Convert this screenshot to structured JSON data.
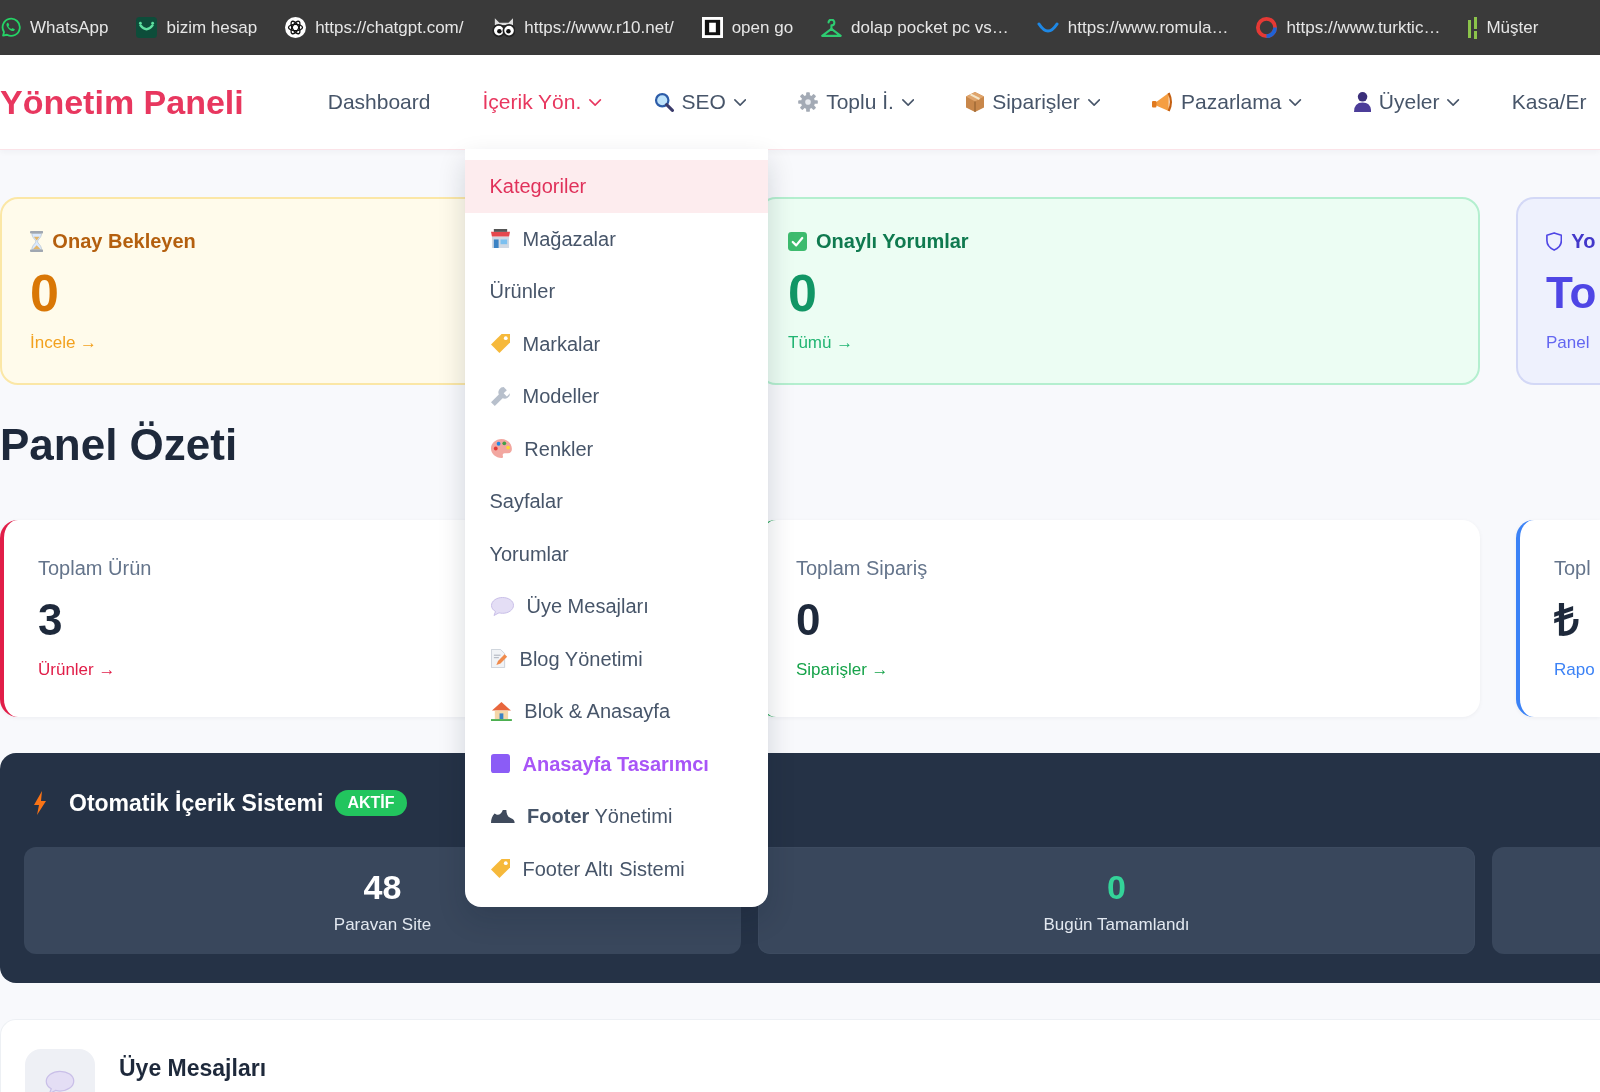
{
  "bookmarks_bar": {
    "items": [
      {
        "label": "WhatsApp"
      },
      {
        "label": "bizim hesap"
      },
      {
        "label": "https://chatgpt.com/"
      },
      {
        "label": "https://www.r10.net/"
      },
      {
        "label": "open go"
      },
      {
        "label": "dolap pocket pc vs…"
      },
      {
        "label": "https://www.romula…"
      },
      {
        "label": "https://www.turktic…"
      },
      {
        "label": "Müşter"
      }
    ]
  },
  "navbar": {
    "brand": "Yönetim Paneli",
    "items": [
      {
        "label": "Dashboard",
        "selected": false,
        "expanded": false,
        "dropdown": false
      },
      {
        "label": "İçerik Yön.",
        "selected": true,
        "expanded": true,
        "dropdown": true
      },
      {
        "label": "SEO",
        "selected": false,
        "expanded": false,
        "dropdown": true
      },
      {
        "label": "Toplu İ.",
        "selected": false,
        "expanded": false,
        "dropdown": true
      },
      {
        "label": "Siparişler",
        "selected": false,
        "expanded": false,
        "dropdown": true
      },
      {
        "label": "Pazarlama",
        "selected": false,
        "expanded": false,
        "dropdown": true
      },
      {
        "label": "Üyeler",
        "selected": false,
        "expanded": false,
        "dropdown": true
      },
      {
        "label": "Kasa/Er",
        "selected": false,
        "expanded": false,
        "dropdown": false
      }
    ]
  },
  "dropdown_menu": {
    "items": [
      {
        "label": "Kategoriler",
        "selected": true,
        "kind": "plain"
      },
      {
        "label": "Mağazalar",
        "selected": false,
        "kind": "plain"
      },
      {
        "label": "Ürünler",
        "selected": false,
        "kind": "plain"
      },
      {
        "label": "Markalar",
        "selected": false,
        "kind": "plain"
      },
      {
        "label": "Modeller",
        "selected": false,
        "kind": "plain"
      },
      {
        "label": "Renkler",
        "selected": false,
        "kind": "plain"
      },
      {
        "label": "Sayfalar",
        "selected": false,
        "kind": "plain"
      },
      {
        "label": "Yorumlar",
        "selected": false,
        "kind": "plain"
      },
      {
        "label": "Üye Mesajları",
        "selected": false,
        "kind": "plain"
      },
      {
        "label": "Blog Yönetimi",
        "selected": false,
        "kind": "plain"
      },
      {
        "label": "Blok & Anasayfa",
        "selected": false,
        "kind": "plain"
      },
      {
        "label": "Anasayfa Tasarımcı",
        "selected": false,
        "kind": "featured"
      },
      {
        "label": "**Footer** Yönetimi",
        "selected": false,
        "kind": "plain"
      },
      {
        "label": "Footer Altı Sistemi",
        "selected": false,
        "kind": "plain"
      }
    ]
  },
  "status_cards": [
    {
      "kind": "warning",
      "title": "Onay Bekleyen",
      "value": "0",
      "link": "İncele →"
    },
    {
      "kind": "success",
      "title": "Onaylı Yorumlar",
      "value": "0",
      "link": "Tümü →"
    },
    {
      "kind": "info",
      "title": "Yo",
      "value": "To",
      "link": "Panel"
    }
  ],
  "summary": {
    "title": "Panel Özeti",
    "cards": [
      {
        "title": "Toplam Ürün",
        "value": "3",
        "link": "Ürünler →",
        "color": "#e11d48"
      },
      {
        "title": "Toplam Sipariş",
        "value": "0",
        "link": "Siparişler →",
        "color": "#16a34a"
      },
      {
        "title": "Topl",
        "value": "₺",
        "link": "Rapo",
        "color": "#3b82f6"
      }
    ]
  },
  "auto_content": {
    "title": "Otomatik İçerik Sistemi",
    "badge": "AKTİF",
    "stats": [
      {
        "kind": "plain",
        "value": "48",
        "label": "Paravan Site"
      },
      {
        "kind": "success",
        "value": "0",
        "label": "Bugün Tamamlandı"
      },
      {
        "kind": "plain"
      }
    ]
  },
  "messages_panel": {
    "title": "Üye Mesajları"
  }
}
